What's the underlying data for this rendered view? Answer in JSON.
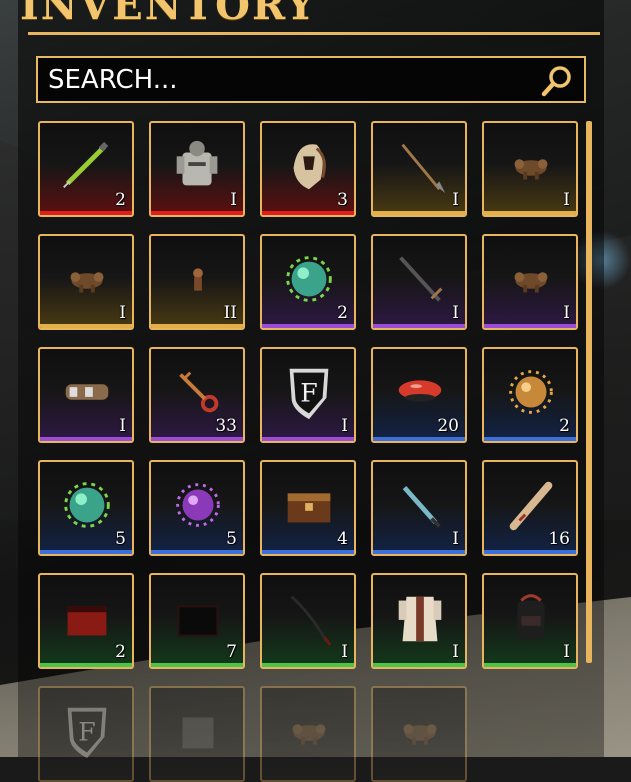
{
  "header": {
    "title": "INVENTORY"
  },
  "search": {
    "placeholder": "SEARCH..."
  },
  "items": [
    {
      "name": "syringe",
      "rarity": "red",
      "qty": "2"
    },
    {
      "name": "armor",
      "rarity": "red",
      "qty": "I"
    },
    {
      "name": "helmet",
      "rarity": "red",
      "qty": "3"
    },
    {
      "name": "spear",
      "rarity": "gold",
      "qty": "I"
    },
    {
      "name": "creature-figure",
      "rarity": "gold",
      "qty": "I"
    },
    {
      "name": "creature-figure",
      "rarity": "gold",
      "qty": "I"
    },
    {
      "name": "small-figure",
      "rarity": "gold",
      "qty": "II"
    },
    {
      "name": "green-orb",
      "rarity": "purple",
      "qty": "2"
    },
    {
      "name": "sword",
      "rarity": "purple",
      "qty": "I"
    },
    {
      "name": "creature-figure",
      "rarity": "purple",
      "qty": "I"
    },
    {
      "name": "scroll-case",
      "rarity": "purple",
      "qty": "I"
    },
    {
      "name": "key",
      "rarity": "purple",
      "qty": "33"
    },
    {
      "name": "shield-emblem",
      "rarity": "purple",
      "qty": "I",
      "emblem_letter": "F"
    },
    {
      "name": "mushroom",
      "rarity": "blue",
      "qty": "20"
    },
    {
      "name": "orange-orb",
      "rarity": "blue",
      "qty": "2"
    },
    {
      "name": "green-orb",
      "rarity": "blue",
      "qty": "5"
    },
    {
      "name": "purple-orb",
      "rarity": "blue",
      "qty": "5"
    },
    {
      "name": "chest",
      "rarity": "blue",
      "qty": "4"
    },
    {
      "name": "dagger",
      "rarity": "blue",
      "qty": "I"
    },
    {
      "name": "scroll",
      "rarity": "blue",
      "qty": "16"
    },
    {
      "name": "red-chest",
      "rarity": "green",
      "qty": "2"
    },
    {
      "name": "dark-chest",
      "rarity": "green",
      "qty": "7"
    },
    {
      "name": "katana",
      "rarity": "green",
      "qty": "I"
    },
    {
      "name": "robe",
      "rarity": "green",
      "qty": "I"
    },
    {
      "name": "backpack",
      "rarity": "green",
      "qty": "I"
    },
    {
      "name": "shield-emblem",
      "rarity": "faded",
      "qty": ""
    },
    {
      "name": "unknown",
      "rarity": "faded",
      "qty": ""
    },
    {
      "name": "creature-figure",
      "rarity": "faded",
      "qty": ""
    },
    {
      "name": "creature-figure",
      "rarity": "faded",
      "qty": ""
    }
  ],
  "colors": {
    "accent": "#e8b55e",
    "title": "#f2c46b"
  }
}
